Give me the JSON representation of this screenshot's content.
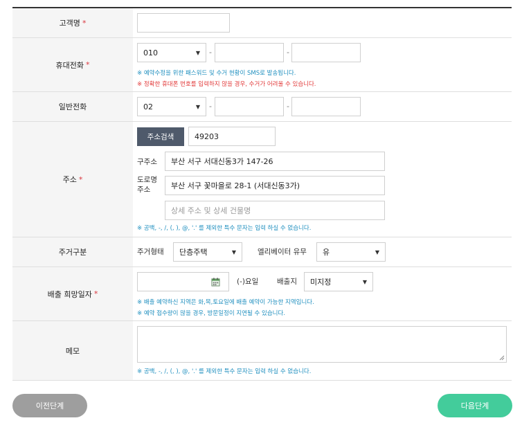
{
  "customer_name": {
    "label": "고객명",
    "required_mark": "*",
    "value": ""
  },
  "mobile_phone": {
    "label": "휴대전화",
    "required_mark": "*",
    "prefix": "010",
    "dash": "-",
    "middle": "",
    "last": "",
    "note_blue": "※ 예약수정을 위한 패스워드 및 수거 현황이 SMS로 발송됩니다.",
    "note_red": "※ 정확한 휴대폰 번호를 입력하지 않을 경우, 수거가 어려울 수 있습니다."
  },
  "landline": {
    "label": "일반전화",
    "prefix": "02",
    "dash": "-",
    "middle": "",
    "last": ""
  },
  "address": {
    "label": "주소",
    "required_mark": "*",
    "search_button": "주소검색",
    "zipcode": "49203",
    "old_address_label": "구주소",
    "old_address": "부산 서구 서대신동3가 147-26",
    "road_address_label_line1": "도로명",
    "road_address_label_line2": "주소",
    "road_address": "부산 서구 꽃마을로 28-1 (서대신동3가)",
    "detail_placeholder": "상세 주소 및 상세 건물명",
    "note": "※ 공백, -, /, (, ), @, '.' 를 제외한 특수 문자는 입력 하실 수 없습니다."
  },
  "residence": {
    "label": "주거구분",
    "type_label": "주거형태",
    "type_value": "단층주택",
    "elevator_label": "엘리베이터 유무",
    "elevator_value": "유"
  },
  "pickup_date": {
    "label": "배출 희망일자",
    "required_mark": "*",
    "date_value": "",
    "weekday_text": "(-)요일",
    "location_label": "배출지",
    "location_value": "미지정",
    "note1": "※ 배출 예약하신 지역은 화,목,토요일에 배출 예약이 가능한 지역입니다.",
    "note2": "※ 예약 접수량이 많을 경우, 방문일정이 지연될 수 있습니다."
  },
  "memo": {
    "label": "메모",
    "value": "",
    "note": "※ 공백, -, /, (, ), @, '.' 를 제외한 특수 문자는 입력 하실 수 없습니다."
  },
  "buttons": {
    "prev": "이전단계",
    "next": "다음단계"
  },
  "colors": {
    "next_button": "#43cc9b",
    "prev_button": "#9e9e9e",
    "search_button": "#4f5a6b",
    "required": "#d9363e",
    "note_blue": "#1f8fbf",
    "note_red": "#e23a3a"
  },
  "icons": {
    "dropdown": "caret-down-icon",
    "calendar": "calendar-icon"
  }
}
